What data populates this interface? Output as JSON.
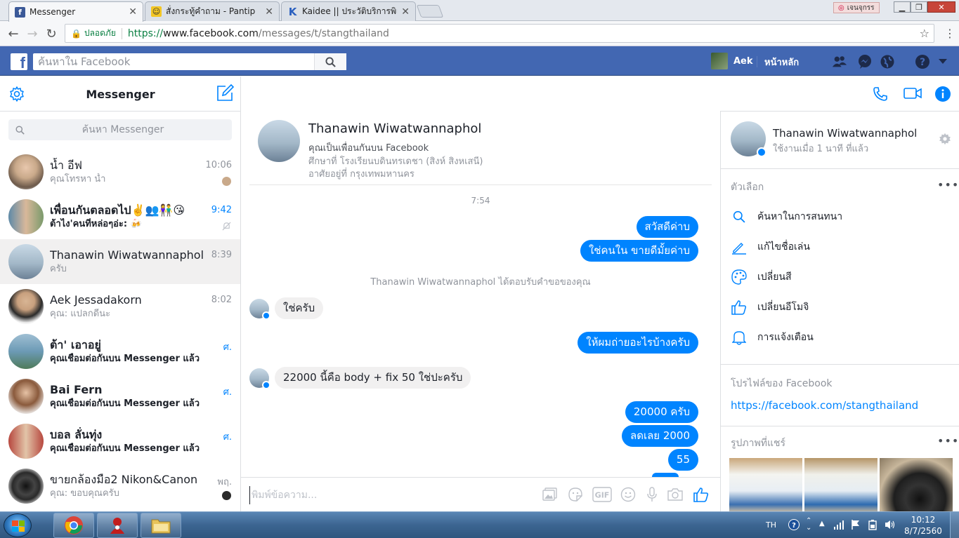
{
  "browser": {
    "tabs": [
      {
        "title": "Messenger",
        "active": true,
        "favicon": "facebook-icon"
      },
      {
        "title": "สั่งกระทู้คำถาม - Pantip",
        "active": false,
        "favicon": "pantip-icon"
      },
      {
        "title": "Kaidee || ประวัติบริการพิเศษ",
        "active": false,
        "favicon": "kaidee-icon"
      }
    ],
    "user_chip": "เจนจุกรร",
    "address": {
      "secure_label": "ปลอดภัย",
      "scheme": "https://",
      "host": "www.facebook.com",
      "path": "/messages/t/stangthailand"
    }
  },
  "fb_header": {
    "logo": "f",
    "search_placeholder": "ค้นหาใน Facebook",
    "user_name": "Aek",
    "home_label": "หน้าหลัก"
  },
  "sidebar": {
    "title": "Messenger",
    "search_placeholder": "ค้นหา Messenger",
    "conversations": [
      {
        "name": "น้ำ อีฟ",
        "snippet": "คุณโทรหา น้ำ",
        "time": "10:06",
        "unread": false,
        "avatar_color": "#c9a98a"
      },
      {
        "name": "เพื่อนกันตลอดไป✌️👥👫😘",
        "snippet": "ต้าไง'คนที่หล่อๆอ่ะ: 🍻",
        "time": "9:42",
        "unread": true,
        "avatar_color": "#5e8aa8"
      },
      {
        "name": "Thanawin Wiwatwannaphol",
        "snippet": "ครับ",
        "time": "8:39",
        "unread": false,
        "selected": true,
        "avatar_color": "#9fb3c4"
      },
      {
        "name": "Aek Jessadakorn",
        "snippet": "คุณ: แปลกดีนะ",
        "time": "8:02",
        "unread": false,
        "avatar_color": "#d8c0a2"
      },
      {
        "name": "ต้า' เอาอยู่",
        "snippet": "คุณเชื่อมต่อกันบน Messenger แล้ว",
        "time": "ศ.",
        "unread": true,
        "avatar_color": "#6c9ab5"
      },
      {
        "name": "Bai Fern",
        "snippet": "คุณเชื่อมต่อกันบน Messenger แล้ว",
        "time": "ศ.",
        "unread": true,
        "avatar_color": "#8a5a3c"
      },
      {
        "name": "บอล ลั่นทุ่ง",
        "snippet": "คุณเชื่อมต่อกันบน Messenger แล้ว",
        "time": "ศ.",
        "unread": true,
        "avatar_color": "#b7483f"
      },
      {
        "name": "ขายกล้องมือ2 Nikon&Canon",
        "snippet": "คุณ: ขอบคุณครับ",
        "time": "พฤ.",
        "unread": false,
        "avatar_color": "#2a2a2a"
      }
    ]
  },
  "thread": {
    "name": "Thanawin Wiwatwannaphol",
    "status": "ใช้งานเมื่อ 1 นาที ที่แล้ว",
    "profile": {
      "name": "Thanawin Wiwatwannaphol",
      "friend_line": "คุณเป็นเพื่อนกันบน Facebook",
      "school": "ศึกษาที่ โรงเรียนบดินทรเดชา (สิงห์ สิงหเสนี)",
      "lives": "อาศัยอยู่ที่ กรุงเทพมหานคร"
    },
    "timestamp": "7:54",
    "system_message": "Thanawin Wiwatwannaphol ได้ตอบรับคำขอของคุณ",
    "messages": [
      {
        "text": "สวัสดีค่าบ",
        "dir": "out"
      },
      {
        "text": "ใช่คนใน ขายดีมั้ยค่าบ",
        "dir": "out"
      },
      {
        "text": "ใช่ครับ",
        "dir": "in"
      },
      {
        "text": "ให้ผมถ่ายอะไรบ้างครับ",
        "dir": "out"
      },
      {
        "text": "22000 นี้คือ  body + fix 50 ใช่ปะครับ",
        "dir": "in"
      },
      {
        "text": "20000 ครับ",
        "dir": "out"
      },
      {
        "text": "ลดเลย 2000",
        "dir": "out"
      },
      {
        "text": "55",
        "dir": "out"
      }
    ],
    "composer_placeholder": "พิมพ์ข้อความ..."
  },
  "details": {
    "name": "Thanawin Wiwatwannaphol",
    "status": "ใช้งานเมื่อ 1 นาที ที่แล้ว",
    "options_title": "ตัวเลือก",
    "options": [
      {
        "label": "ค้นหาในการสนทนา",
        "icon": "search-icon"
      },
      {
        "label": "แก้ไขชื่อเล่น",
        "icon": "pencil-icon"
      },
      {
        "label": "เปลี่ยนสี",
        "icon": "palette-icon"
      },
      {
        "label": "เปลี่ยนอีโมจิ",
        "icon": "thumbs-up-icon"
      },
      {
        "label": "การแจ้งเตือน",
        "icon": "bell-icon"
      }
    ],
    "profile_title": "โปรไฟล์ของ Facebook",
    "profile_link": "https://facebook.com/stangthailand",
    "photos_title": "รูปภาพที่แชร์"
  },
  "taskbar": {
    "lang": "TH",
    "time": "10:12",
    "date": "8/7/2560"
  },
  "colors": {
    "fb_blue": "#4267b2",
    "messenger_blue": "#0084ff"
  }
}
